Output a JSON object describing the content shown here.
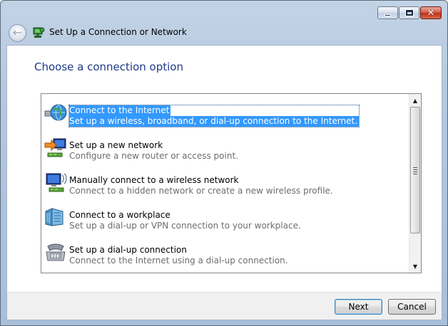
{
  "window": {
    "title": "Set Up a Connection or Network",
    "close_glyph": "✕",
    "back_glyph": "←"
  },
  "page": {
    "heading": "Choose a connection option"
  },
  "options": [
    {
      "title": "Connect to the Internet",
      "description": "Set up a wireless, broadband, or dial-up connection to the Internet.",
      "icon": "globe-network-icon",
      "selected": true
    },
    {
      "title": "Set up a new network",
      "description": "Configure a new router or access point.",
      "icon": "new-network-icon",
      "selected": false
    },
    {
      "title": "Manually connect to a wireless network",
      "description": "Connect to a hidden network or create a new wireless profile.",
      "icon": "wireless-network-icon",
      "selected": false
    },
    {
      "title": "Connect to a workplace",
      "description": "Set up a dial-up or VPN connection to your workplace.",
      "icon": "workplace-icon",
      "selected": false
    },
    {
      "title": "Set up a dial-up connection",
      "description": "Connect to the Internet using a dial-up connection.",
      "icon": "phone-icon",
      "selected": false
    }
  ],
  "buttons": {
    "next": "Next",
    "cancel": "Cancel"
  },
  "colors": {
    "selection": "#3399ff",
    "heading": "#1e3a8a"
  }
}
